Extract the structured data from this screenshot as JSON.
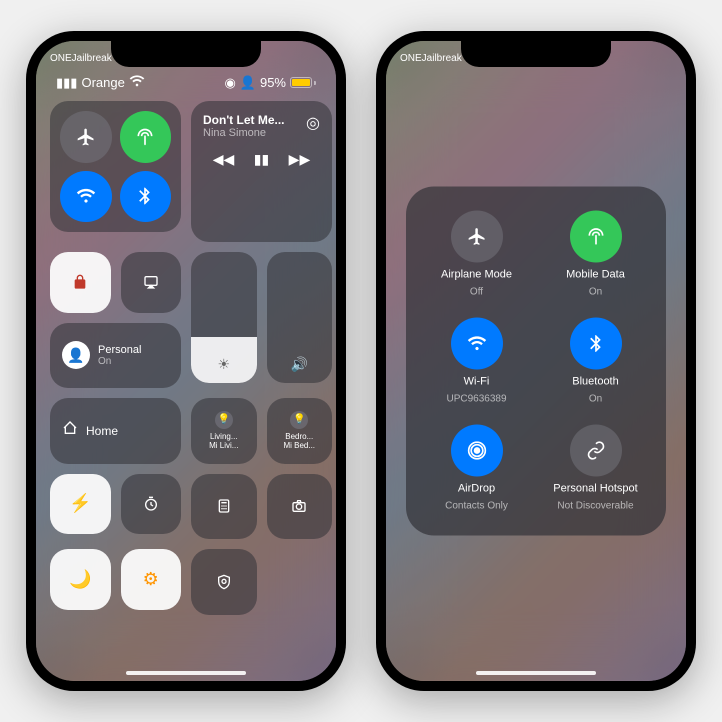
{
  "watermark": "ONEJailbreak",
  "status": {
    "carrier": "Orange",
    "battery_pct": "95%"
  },
  "media": {
    "title": "Don't Let Me...",
    "artist": "Nina Simone"
  },
  "focus": {
    "label": "Personal",
    "status": "On"
  },
  "home": {
    "label": "Home"
  },
  "devices": {
    "living": {
      "name": "Living...",
      "sub": "Mi Livi..."
    },
    "bedroom": {
      "name": "Bedro...",
      "sub": "Mi Bed..."
    }
  },
  "brightness_fill": "35%",
  "volume_fill": "0%",
  "expanded": {
    "airplane": {
      "label": "Airplane Mode",
      "status": "Off"
    },
    "mobile": {
      "label": "Mobile Data",
      "status": "On"
    },
    "wifi": {
      "label": "Wi-Fi",
      "status": "UPC9636389"
    },
    "bluetooth": {
      "label": "Bluetooth",
      "status": "On"
    },
    "airdrop": {
      "label": "AirDrop",
      "status": "Contacts Only"
    },
    "hotspot": {
      "label": "Personal Hotspot",
      "status": "Not Discoverable"
    }
  }
}
